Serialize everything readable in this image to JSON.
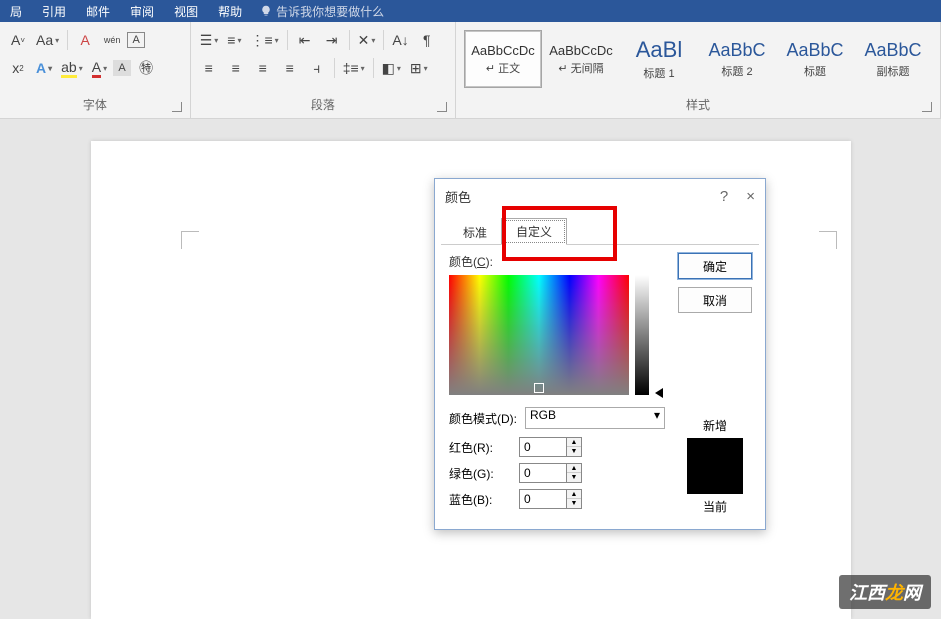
{
  "menu": {
    "items": [
      "局",
      "引用",
      "邮件",
      "审阅",
      "视图",
      "帮助"
    ],
    "tell_me": "告诉我你想要做什么"
  },
  "ribbon": {
    "font_label": "字体",
    "para_label": "段落",
    "styles_label": "样式"
  },
  "styles": [
    {
      "preview": "AaBbCcDc",
      "label": "↵ 正文",
      "cls": ""
    },
    {
      "preview": "AaBbCcDc",
      "label": "↵ 无间隔",
      "cls": ""
    },
    {
      "preview": "AaBl",
      "label": "标题 1",
      "cls": "big"
    },
    {
      "preview": "AaBbC",
      "label": "标题 2",
      "cls": "med"
    },
    {
      "preview": "AaBbC",
      "label": "标题",
      "cls": "med"
    },
    {
      "preview": "AaBbC",
      "label": "副标题",
      "cls": "med"
    }
  ],
  "dialog": {
    "title": "颜色",
    "help": "?",
    "close": "×",
    "tab_standard": "标准",
    "tab_custom": "自定义",
    "ok": "确定",
    "cancel": "取消",
    "color_label_pre": "颜色(",
    "color_label_u": "C",
    "color_label_post": "):",
    "mode_label_pre": "颜色模式(",
    "mode_label_u": "D",
    "mode_label_post": "):",
    "mode_value": "RGB",
    "r_pre": "红色(",
    "r_u": "R",
    "r_post": "):",
    "g_pre": "绿色(",
    "g_u": "G",
    "g_post": "):",
    "b_pre": "蓝色(",
    "b_u": "B",
    "b_post": "):",
    "r_val": "0",
    "g_val": "0",
    "b_val": "0",
    "new_label": "新增",
    "current_label": "当前"
  },
  "watermark": {
    "pre": "江西",
    "mid": "龙",
    "post": "网"
  }
}
